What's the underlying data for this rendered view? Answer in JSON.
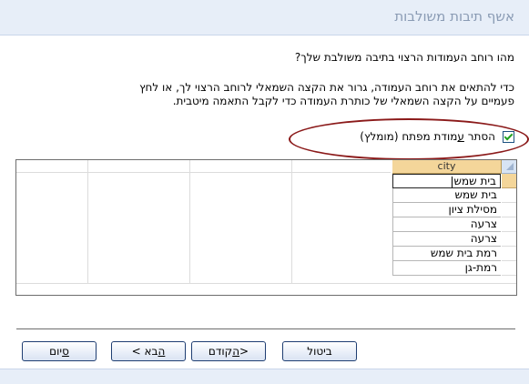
{
  "window": {
    "title": "אשף תיבות משולבות"
  },
  "question": "מהו רוחב העמודות הרצוי בתיבה משולבת שלך?",
  "instructions_line1": "כדי להתאים את רוחב העמודה, גרור את הקצה השמאלי לרוחב הרצוי לך, או לחץ",
  "instructions_line2": "פעמיים על הקצה השמאלי של כותרת העמודה כדי לקבל התאמה מיטבית.",
  "checkbox": {
    "label_before": "הסתר ",
    "label_mnemonic": "ע",
    "label_after": "מודת מפתח (מומלץ)",
    "checked": true
  },
  "grid": {
    "column_header": "city",
    "rows": [
      "בית שמש",
      "בית שמש",
      "מסילת ציון",
      "צרעה",
      "צרעה",
      "רמת בית שמש",
      "רמת-גן"
    ]
  },
  "buttons": {
    "cancel": "ביטול",
    "back_prefix": "<",
    "back_mnemonic": "ה",
    "back_suffix": "קודם",
    "next_mnemonic": "ה",
    "next_rest": "בא",
    "next_suffix": " >",
    "finish_mnemonic": "ס",
    "finish_rest": "יום"
  },
  "colors": {
    "title_bar": "#e7eef8",
    "annotation_ellipse": "#8b1a1a",
    "column_header": "#f4d69a",
    "button_border": "#1f3e72"
  }
}
